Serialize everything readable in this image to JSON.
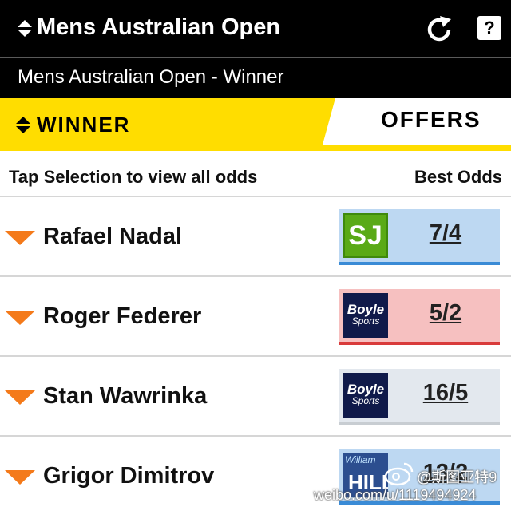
{
  "header": {
    "title": "Mens Australian Open",
    "subtitle": "Mens Australian Open - Winner",
    "refresh_icon": "refresh-icon",
    "help_label": "?"
  },
  "tabs": {
    "winner_label": "WINNER",
    "offers_label": "OFFERS"
  },
  "list": {
    "hint": "Tap Selection to view all odds",
    "best_odds_label": "Best Odds",
    "rows": [
      {
        "name": "Rafael Nadal",
        "odds": "7/4",
        "bookmaker": "SJ",
        "style": "blue"
      },
      {
        "name": "Roger Federer",
        "odds": "5/2",
        "bookmaker": "Boyle Sports",
        "style": "pink"
      },
      {
        "name": "Stan Wawrinka",
        "odds": "16/5",
        "bookmaker": "Boyle Sports",
        "style": "grey"
      },
      {
        "name": "Grigor Dimitrov",
        "odds": "13/2",
        "bookmaker": "William Hill",
        "style": "blue"
      }
    ]
  },
  "bookmakers": {
    "sj": "SJ",
    "boyle_line1": "Boyle",
    "boyle_line2": "Sports",
    "wh_line1": "William",
    "wh_line2": "HILL"
  },
  "watermark": {
    "handle": "@斯图亚特9",
    "url": "weibo.com/u/1119494924"
  },
  "colors": {
    "accent_yellow": "#ffdd00",
    "expand_orange": "#f47a1a",
    "odds_blue": "#bdd8f2",
    "odds_pink": "#f6c0c0",
    "odds_grey": "#e3e8ee"
  }
}
